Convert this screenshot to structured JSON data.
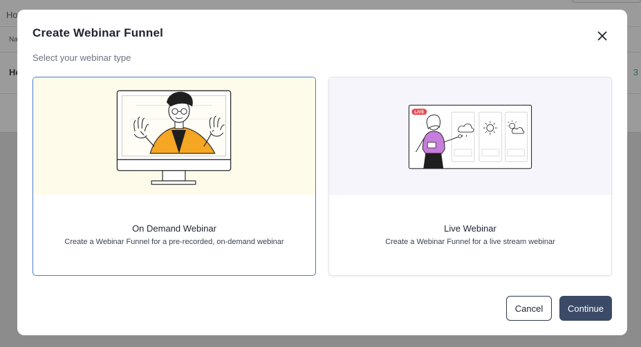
{
  "background": {
    "breadcrumb": "Ho",
    "column_header": "Na",
    "row_label": "He",
    "row_count": "3"
  },
  "modal": {
    "title": "Create Webinar Funnel",
    "subtitle": "Select your webinar type",
    "close_icon": "close-icon",
    "cards": [
      {
        "title": "On Demand Webinar",
        "description": "Create a Webinar Funnel for a pre-recorded, on-demand webinar",
        "selected": true,
        "illustration": "person-waving-on-monitor"
      },
      {
        "title": "Live Webinar",
        "description": "Create a Webinar Funnel for a live stream webinar",
        "selected": false,
        "illustration": "presenter-weather-board",
        "badge": "LIVE"
      }
    ],
    "cancel_label": "Cancel",
    "continue_label": "Continue"
  },
  "colors": {
    "accent": "#3b4a66",
    "selected_border": "#4a7cc4",
    "on_demand_bg": "#fffbeb",
    "live_bg": "#f7f5fc",
    "illustration_orange": "#f5a623",
    "illustration_purple": "#c77ddb",
    "live_badge": "#e5484d"
  }
}
